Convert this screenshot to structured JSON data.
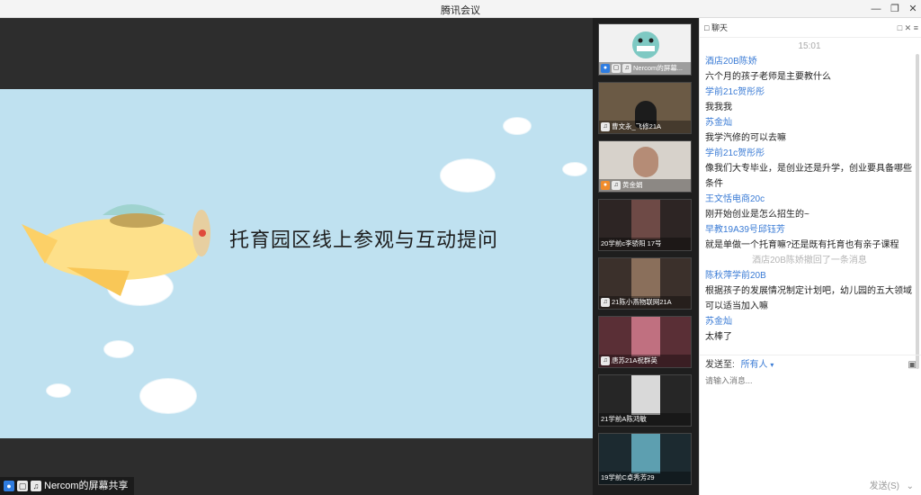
{
  "window": {
    "title": "腾讯会议",
    "minimize": "—",
    "restore": "❐",
    "close": "✕"
  },
  "share": {
    "label": "Nercom的屏幕共享"
  },
  "slide": {
    "title": "托育园区线上参观与互动提问"
  },
  "videos": [
    {
      "name": "Nercom的屏幕...",
      "icons": [
        "user-icon",
        "screen-icon",
        "mic-icon"
      ]
    },
    {
      "name": "曹文永_飞修21A",
      "icons": [
        "mic-icon"
      ]
    },
    {
      "name": "黄金娟",
      "icons": [
        "user-icon",
        "mic-icon"
      ]
    },
    {
      "name": "20学前c李骄阳 17号",
      "icons": []
    },
    {
      "name": "21陈小燕物联网21A",
      "icons": [
        "mic-icon"
      ]
    },
    {
      "name": "唐苏21A祝群英",
      "icons": [
        "mic-icon"
      ]
    },
    {
      "name": "21学前A陈鸿敏",
      "icons": []
    },
    {
      "name": "19学前C卓秀芳29",
      "icons": []
    }
  ],
  "chat": {
    "title": "聊天",
    "time": "15:01",
    "messages": [
      {
        "sender": "酒店20B陈娇",
        "text": "六个月的孩子老师是主要教什么"
      },
      {
        "sender": "学前21c贺彤彤",
        "text": "我我我"
      },
      {
        "sender": "苏金灿",
        "text": "我学汽修的可以去嘛"
      },
      {
        "sender": "学前21c贺彤彤",
        "text": "像我们大专毕业，是创业还是升学，创业要具备哪些条件"
      },
      {
        "sender": "王文恬电商20c",
        "text": "刚开始创业是怎么招生的~"
      },
      {
        "sender": "早教19A39号邱钰芳",
        "text": "就是单做一个托育嘛?还是既有托育也有亲子课程"
      },
      {
        "notice": "酒店20B陈娇撤回了一条消息"
      },
      {
        "sender": "陈秋萍学前20B",
        "text": "根据孩子的发展情况制定计划吧，幼儿园的五大领域可以适当加入嘛"
      },
      {
        "sender": "苏金灿",
        "text": "太棒了"
      }
    ],
    "send_to_label": "发送至:",
    "send_to_value": "所有人",
    "input_placeholder": "请输入消息...",
    "send_button": "发送(S)"
  }
}
